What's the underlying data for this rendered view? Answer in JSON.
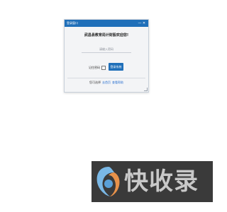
{
  "window": {
    "title": "登录窗口",
    "minimize": "—",
    "close": "✕"
  },
  "heading": "武昌县教育局计财股欢迎您!",
  "password_field": {
    "placeholder": "请输入密码",
    "value": ""
  },
  "remember_label": "记住密码",
  "login_button": "登录系统",
  "footer": {
    "prefix": "您可选择",
    "link_1": "去首页",
    "link_2": "查看帮助"
  },
  "watermark": {
    "text": "快收录"
  },
  "colors": {
    "titlebar": "#1f6fb9",
    "button": "#1f6fb9",
    "link": "#2a6fcf",
    "dialog_bg": "#f3f4f6"
  }
}
